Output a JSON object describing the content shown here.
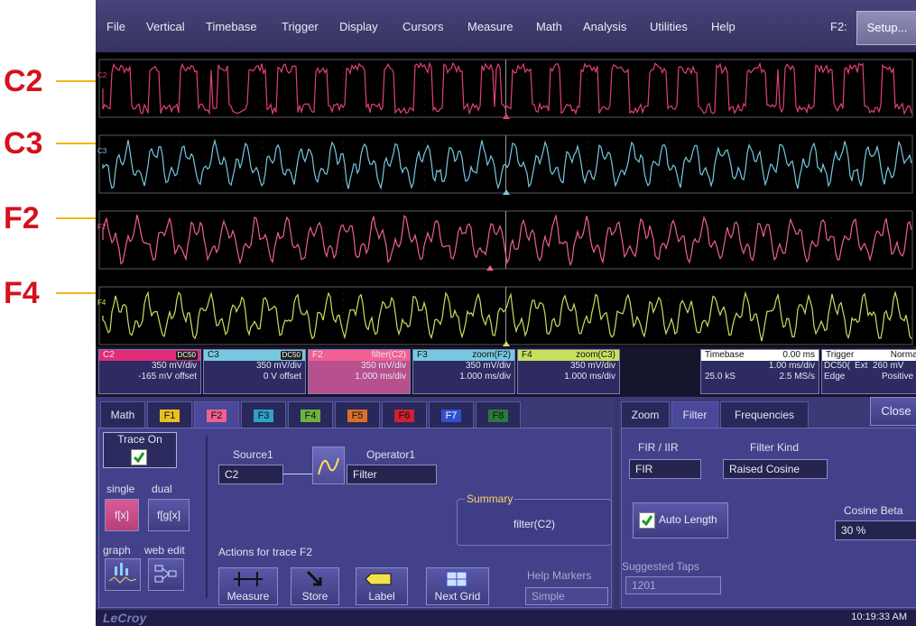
{
  "callouts": [
    "C2",
    "C3",
    "F2",
    "F4"
  ],
  "menu": {
    "items": [
      "File",
      "Vertical",
      "Timebase",
      "Trigger",
      "Display",
      "Cursors",
      "Measure",
      "Math",
      "Analysis",
      "Utilities",
      "Help"
    ],
    "function_label": "F2:",
    "setup_button": "Setup..."
  },
  "trace_markers": [
    "C2",
    "C3",
    "F2",
    "F4"
  ],
  "trace_colors": {
    "C2": "#e0407a",
    "C3": "#78c8e0",
    "F2": "#f06090",
    "F4": "#c8e060"
  },
  "descriptors": [
    {
      "name": "C2",
      "badge": "DC50",
      "line1": "350 mV/div",
      "line2": "-165 mV offset",
      "color": "#e02d7a"
    },
    {
      "name": "C3",
      "badge": "DC50",
      "line1": "350 mV/div",
      "line2": "0 V offset",
      "color": "#78c8e0"
    },
    {
      "name": "F2",
      "title": "filter(C2)",
      "line1": "350 mV/div",
      "line2": "1.000 ms/div",
      "color": "#f06090"
    },
    {
      "name": "F3",
      "title": "zoom(F2)",
      "line1": "350 mV/div",
      "line2": "1.000 ms/div",
      "color": "#78c8e0"
    },
    {
      "name": "F4",
      "title": "zoom(C3)",
      "line1": "350 mV/div",
      "line2": "1.000 ms/div",
      "color": "#c8e060"
    }
  ],
  "timebase": {
    "label": "Timebase",
    "value": "0.00 ms",
    "div": "1.00 ms/div",
    "samples": "25.0 kS",
    "rate": "2.5 MS/s"
  },
  "trigger": {
    "label": "Trigger",
    "mode": "Normal",
    "row2a": "DC50(",
    "row2b": "Ext",
    "row2c": "260 mV",
    "row3a": "Edge",
    "row3b": "Positive"
  },
  "left_tabs": [
    "Math",
    "F1",
    "F2",
    "F3",
    "F4",
    "F5",
    "F6",
    "F7",
    "F8"
  ],
  "left": {
    "trace_on": "Trace On",
    "single": "single",
    "dual": "dual",
    "single_btn": "f[x]",
    "dual_btn": "f[g[x]",
    "graph": "graph",
    "web_edit": "web edit",
    "source1_label": "Source1",
    "source1_value": "C2",
    "operator1_label": "Operator1",
    "operator1_value": "Filter",
    "summary_label": "Summary",
    "summary_value": "filter(C2)",
    "actions_label": "Actions for trace F2",
    "measure": "Measure",
    "store": "Store",
    "label": "Label",
    "next_grid": "Next Grid",
    "help_markers_label": "Help Markers",
    "help_markers_value": "Simple"
  },
  "right_tabs": [
    "Zoom",
    "Filter",
    "Frequencies"
  ],
  "right": {
    "close": "Close",
    "fir_iir_label": "FIR / IIR",
    "fir_iir_value": "FIR",
    "filter_kind_label": "Filter Kind",
    "filter_kind_value": "Raised Cosine",
    "auto_length": "Auto Length",
    "cosine_beta_label": "Cosine Beta",
    "cosine_beta_value": "30 %",
    "suggested_taps_label": "Suggested Taps",
    "suggested_taps_value": "1201"
  },
  "status": {
    "brand": "LeCroy",
    "time": "10:19:33 AM"
  }
}
